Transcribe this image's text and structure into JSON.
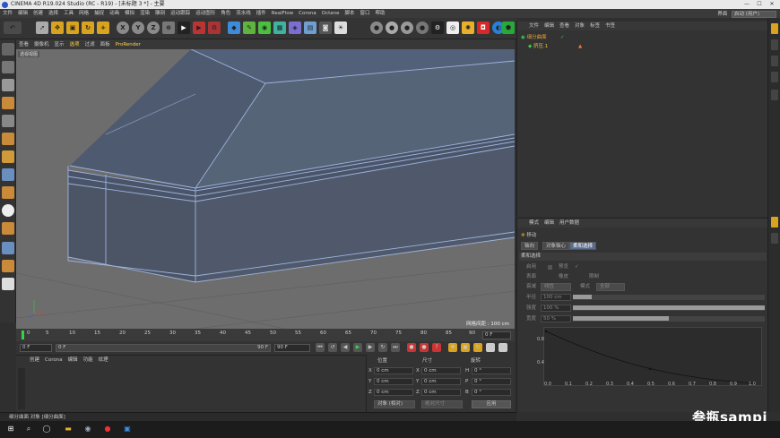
{
  "window": {
    "title": "CINEMA 4D R19.024 Studio (RC - R19) - [未标题 3 *] - 主要"
  },
  "menu": [
    "文件",
    "编辑",
    "创建",
    "选择",
    "工具",
    "网格",
    "捕捉",
    "动画",
    "模拟",
    "渲染",
    "雕刻",
    "运动跟踪",
    "运动图形",
    "角色",
    "流水线",
    "插件",
    "RealFlow",
    "Corona",
    "Octane",
    "脚本",
    "窗口",
    "帮助"
  ],
  "layout": {
    "label": "界面",
    "value": "启动 (用户)"
  },
  "viewport": {
    "menu": [
      "查看",
      "摄像机",
      "显示",
      "选项",
      "过滤",
      "面板",
      "ProRender"
    ],
    "label": "透视视图",
    "grid_info": "网格间距 : 100 cm"
  },
  "timeline": {
    "ticks": [
      "0",
      "5",
      "10",
      "15",
      "20",
      "25",
      "30",
      "35",
      "40",
      "45",
      "50",
      "55",
      "60",
      "65",
      "70",
      "75",
      "80",
      "85",
      "90"
    ],
    "end_field": "0 F"
  },
  "playback": {
    "current": "0 F",
    "start": "0 F",
    "mid": "90 F",
    "end": "90 F"
  },
  "materials": {
    "menu": [
      "创建",
      "Corona",
      "编辑",
      "功能",
      "纹理"
    ]
  },
  "coords": {
    "headers": {
      "pos": "位置",
      "size": "尺寸",
      "rot": "旋转"
    },
    "rows": [
      {
        "axis": "X",
        "pos": "0 cm",
        "saxis": "X",
        "size": "0 cm",
        "raxis": "H",
        "rot": "0 °"
      },
      {
        "axis": "Y",
        "pos": "0 cm",
        "saxis": "Y",
        "size": "0 cm",
        "raxis": "P",
        "rot": "0 °"
      },
      {
        "axis": "Z",
        "pos": "0 cm",
        "saxis": "Z",
        "size": "0 cm",
        "raxis": "B",
        "rot": "0 °"
      }
    ],
    "mode": "对象 (相对)",
    "size_mode": "绝对尺寸",
    "apply": "应用"
  },
  "status": {
    "text": "细分曲面 对象 [细分曲面]"
  },
  "objects": {
    "menu": [
      "文件",
      "编辑",
      "查看",
      "对象",
      "标签",
      "书签"
    ],
    "items": [
      {
        "name": "细分曲面"
      },
      {
        "name": "挤压.1"
      }
    ]
  },
  "attributes": {
    "menu": [
      "模式",
      "编辑",
      "用户数据"
    ],
    "tool": "移动",
    "tabs": [
      "轴向",
      "对象轴心",
      "柔和选择"
    ],
    "section": "柔和选择",
    "props": [
      {
        "label": "启用",
        "value": ""
      },
      {
        "label": "预览",
        "value": "✓"
      },
      {
        "label": "表面",
        "value": ""
      },
      {
        "label": "橡皮",
        "value": ""
      },
      {
        "label": "限制",
        "value": ""
      },
      {
        "label": "衰减",
        "value": "线性"
      },
      {
        "label": "模式",
        "value": "全部"
      },
      {
        "label": "半径",
        "value": "100 cm"
      },
      {
        "label": "强度",
        "value": "100 %"
      },
      {
        "label": "宽度",
        "value": "50 %"
      }
    ],
    "bars": {
      "radius": 0.1,
      "strength": 1.0,
      "width": 0.5
    },
    "graph": {
      "y_labels": [
        "0.8",
        "0.4"
      ],
      "x_labels": [
        "0.0",
        "0.1",
        "0.2",
        "0.3",
        "0.4",
        "0.5",
        "0.6",
        "0.7",
        "0.8",
        "0.9",
        "1.0"
      ]
    }
  },
  "watermark": "叁瓶sampi",
  "colors": {
    "accent_green": "#22ff44",
    "selected_tab": "#5a6d8c",
    "mesh_face": "#4b5566",
    "mesh_edge": "#9fb4dd"
  }
}
